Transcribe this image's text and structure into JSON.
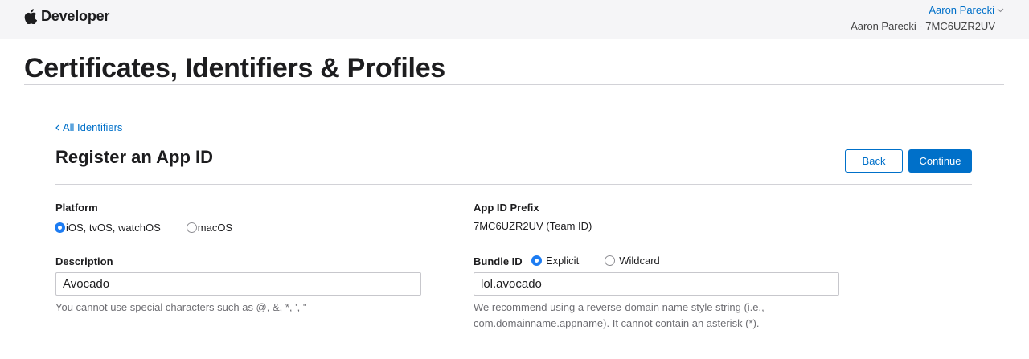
{
  "header": {
    "brand": "Developer",
    "user_name": "Aaron Parecki",
    "team_line": "Aaron Parecki - 7MC6UZR2UV"
  },
  "page": {
    "title": "Certificates, Identifiers & Profiles"
  },
  "nav": {
    "back_link": "All Identifiers"
  },
  "section": {
    "title": "Register an App ID",
    "back_button": "Back",
    "continue_button": "Continue"
  },
  "form": {
    "platform": {
      "label": "Platform",
      "options": [
        "iOS, tvOS, watchOS",
        "macOS"
      ],
      "selected": "iOS, tvOS, watchOS"
    },
    "app_id_prefix": {
      "label": "App ID Prefix",
      "value": "7MC6UZR2UV (Team ID)"
    },
    "description": {
      "label": "Description",
      "value": "Avocado",
      "help": "You cannot use special characters such as @, &, *, ', \""
    },
    "bundle_id": {
      "label": "Bundle ID",
      "options": [
        "Explicit",
        "Wildcard"
      ],
      "selected": "Explicit",
      "value": "lol.avocado",
      "help_line1": "We recommend using a reverse-domain name style string (i.e.,",
      "help_line2": "com.domainname.appname). It cannot contain an asterisk (*)."
    }
  },
  "colors": {
    "accent": "#0070c9",
    "radio_checked": "#1d7cf2",
    "topbar_bg": "#f5f5f7"
  },
  "icons": [
    "apple-logo-icon",
    "chevron-down-icon",
    "chevron-left-icon"
  ]
}
